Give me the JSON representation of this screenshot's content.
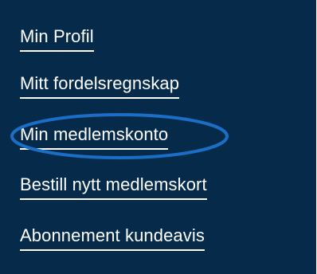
{
  "menu": {
    "items": [
      {
        "label": "Min Profil"
      },
      {
        "label": "Mitt fordelsregnskap"
      },
      {
        "label": "Min medlemskonto",
        "highlighted": true
      },
      {
        "label": "Bestill nytt medlemskort"
      },
      {
        "label": "Abonnement kundeavis"
      }
    ]
  },
  "colors": {
    "panel_background": "#062b4a",
    "link_text": "#ffffff",
    "highlight_ring": "#1a6ec6"
  }
}
